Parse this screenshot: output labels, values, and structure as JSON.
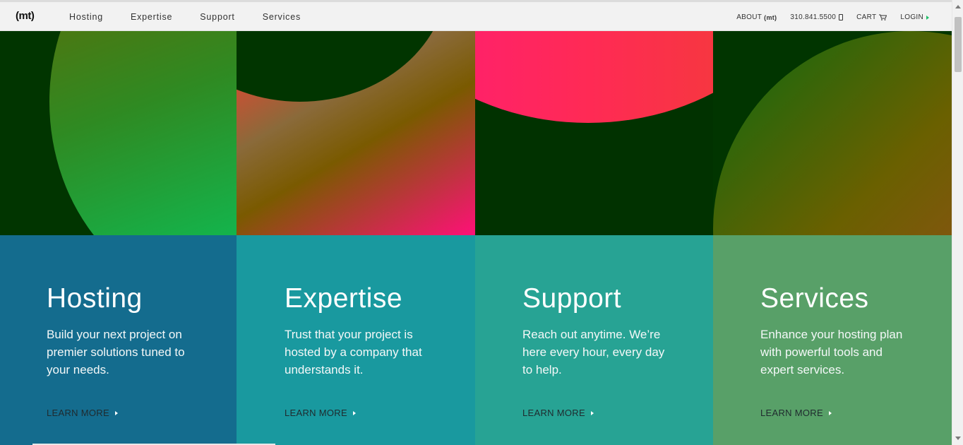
{
  "header": {
    "logo": "(mt)",
    "nav": [
      "Hosting",
      "Expertise",
      "Support",
      "Services"
    ],
    "about_label": "ABOUT",
    "about_logo": "(mt)",
    "phone": "310.841.5500",
    "cart_label": "CART",
    "login_label": "LOGIN"
  },
  "cards": [
    {
      "title": "Hosting",
      "text": "Build your next project on premier solutions tuned to your needs.",
      "link": "LEARN MORE"
    },
    {
      "title": "Expertise",
      "text": "Trust that your project is hosted by a company that understands it.",
      "link": "LEARN MORE"
    },
    {
      "title": "Support",
      "text": "Reach out anytime. We’re here every hour, every day to help.",
      "link": "LEARN MORE"
    },
    {
      "title": "Services",
      "text": "Enhance your hosting plan with powerful tools and expert services.",
      "link": "LEARN MORE"
    }
  ],
  "colors": {
    "hosting": "#146c8e",
    "expertise": "#19999f",
    "support": "#27a394",
    "services": "#58a068",
    "accent_green": "#21c06a"
  },
  "icons": {
    "phone": "phone-icon",
    "cart": "cart-icon",
    "login": "arrow-right-icon",
    "learn_more": "triangle-right-icon"
  }
}
